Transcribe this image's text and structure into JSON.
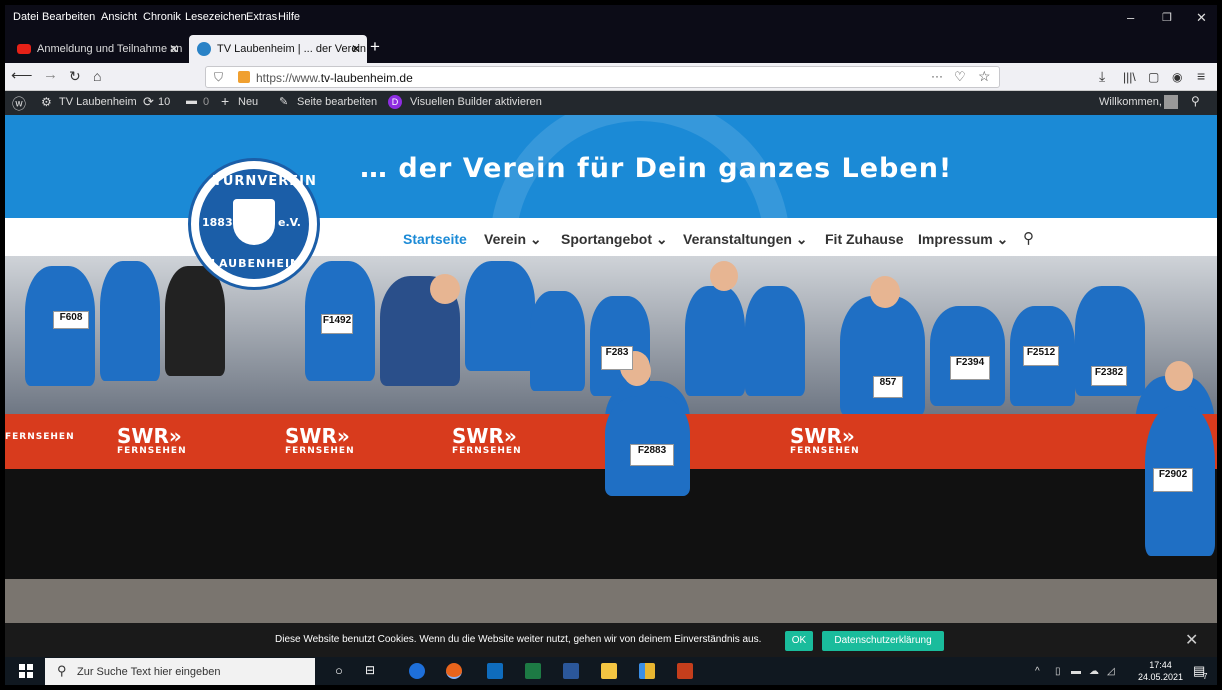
{
  "menubar": {
    "items": [
      "Datei",
      "Bearbeiten",
      "Ansicht",
      "Chronik",
      "Lesezeichen",
      "Extras",
      "Hilfe"
    ]
  },
  "tabs": [
    {
      "title": "Anmeldung und Teilnahme an",
      "close": "✕",
      "icon": "youtube-icon"
    },
    {
      "title": "TV Laubenheim | ... der Verein f",
      "close": "✕",
      "icon": "wordpress-icon"
    }
  ],
  "newtab": "+",
  "navbar": {
    "url": "https://www.tv-laubenheim.de",
    "url_prefix": "https://www.",
    "url_domain": "tv-laubenheim.de",
    "page_actions": "···"
  },
  "wpbar": {
    "site": "TV Laubenheim",
    "updates": "10",
    "comments": "0",
    "new": "Neu",
    "edit": "Seite bearbeiten",
    "builder": "Visuellen Builder aktivieren",
    "builder_badge": "D",
    "welcome": "Willkommen,"
  },
  "site": {
    "tagline": "… der Verein für Dein ganzes Leben!",
    "logo": {
      "top": "TURNVEREIN",
      "year": "1883",
      "ev": "e.V.",
      "bottom": "LAUBENHEIM"
    },
    "nav": [
      {
        "label": "Startseite"
      },
      {
        "label": "Verein ⌄"
      },
      {
        "label": "Sportangebot ⌄"
      },
      {
        "label": "Veranstaltungen ⌄"
      },
      {
        "label": "Fit Zuhause"
      },
      {
        "label": "Impressum ⌄"
      }
    ]
  },
  "photo": {
    "bibs": [
      "F608",
      "F1492",
      "F283",
      "F2883",
      "857",
      "F2394",
      "F2512",
      "F2382",
      "F2902"
    ],
    "banner": {
      "brand": "SWR»",
      "sub": "FERNSEHEN"
    }
  },
  "cookie": {
    "text": "Diese Website benutzt Cookies. Wenn du die Website weiter nutzt, gehen wir von deinem Einverständnis aus.",
    "ok": "OK",
    "privacy": "Datenschutzerklärung",
    "close": "✕"
  },
  "taskbar": {
    "search_placeholder": "Zur Suche Text hier eingeben",
    "time": "17:44",
    "date": "24.05.2021",
    "notif": "7"
  },
  "colors": {
    "brand": "#1b8ad6",
    "cookie_btn": "#1abc9c",
    "wpbar": "#23282d",
    "banner": "#d83b1d"
  }
}
